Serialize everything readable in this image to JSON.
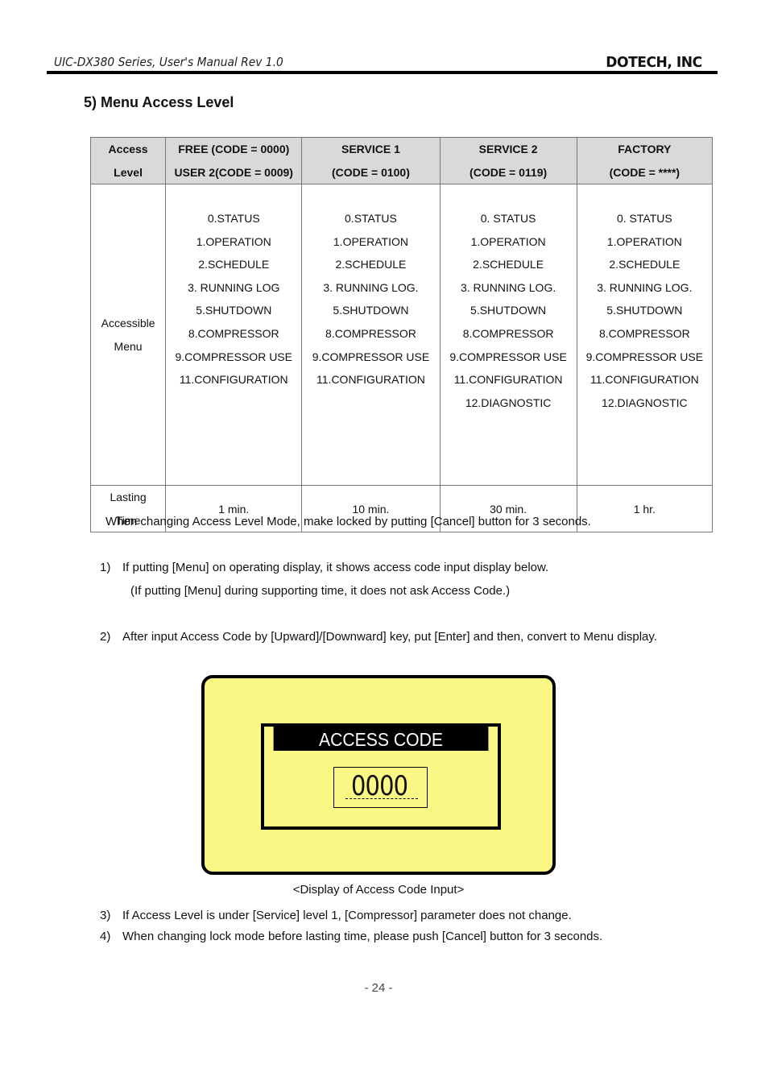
{
  "header": {
    "left": "UIC-DX380 Series, User's Manual Rev 1.0",
    "right": "DOTECH, INC"
  },
  "section_title": "5) Menu Access Level",
  "table": {
    "header": {
      "label": [
        "Access",
        "Level"
      ],
      "columns": [
        [
          "FREE (CODE = 0000)",
          "USER 2(CODE = 0009)"
        ],
        [
          "SERVICE 1",
          "(CODE = 0100)"
        ],
        [
          "SERVICE 2",
          "(CODE = 0119)"
        ],
        [
          "FACTORY",
          "(CODE = ****)"
        ]
      ]
    },
    "menu_row": {
      "label": [
        "Accessible",
        "Menu"
      ],
      "columns": [
        [
          "0.STATUS",
          "1.OPERATION",
          "2.SCHEDULE",
          "3. RUNNING LOG",
          "5.SHUTDOWN",
          "8.COMPRESSOR",
          "9.COMPRESSOR USE",
          "11.CONFIGURATION"
        ],
        [
          "0.STATUS",
          "1.OPERATION",
          "2.SCHEDULE",
          "3. RUNNING LOG.",
          "5.SHUTDOWN",
          "8.COMPRESSOR",
          "9.COMPRESSOR USE",
          "11.CONFIGURATION"
        ],
        [
          "0. STATUS",
          "1.OPERATION",
          "2.SCHEDULE",
          "3. RUNNING LOG.",
          "5.SHUTDOWN",
          "8.COMPRESSOR",
          "9.COMPRESSOR USE",
          "11.CONFIGURATION",
          "12.DIAGNOSTIC"
        ],
        [
          "0. STATUS",
          "1.OPERATION",
          "2.SCHEDULE",
          "3. RUNNING LOG.",
          "5.SHUTDOWN",
          "8.COMPRESSOR",
          "9.COMPRESSOR USE",
          "11.CONFIGURATION",
          "12.DIAGNOSTIC"
        ]
      ]
    },
    "time_row": {
      "label": [
        "Lasting",
        "Time"
      ],
      "values": [
        "1 min.",
        "10 min.",
        "30 min.",
        "1 hr."
      ]
    }
  },
  "note": "When changing Access Level Mode, make locked by putting [Cancel] button for 3 seconds.",
  "steps": [
    {
      "num": "1)",
      "text": "If putting [Menu] on operating display, it shows access code input display below.",
      "sub": "(If putting [Menu] during supporting time, it does not ask Access Code.)"
    },
    {
      "num": "2)",
      "text": "After input Access Code by [Upward]/[Downward] key, put [Enter] and then, convert to Menu display."
    },
    {
      "num": "3)",
      "text": "If Access Level is under [Service] level 1, [Compressor] parameter does not change."
    },
    {
      "num": "4)",
      "text": "When changing lock mode before lasting time, please push [Cancel] button for 3 seconds."
    }
  ],
  "lcd": {
    "title": "ACCESS CODE",
    "code": "0000",
    "bg_color": "#fbf784"
  },
  "caption": "<Display of Access Code Input>",
  "page_number": "- 24 -"
}
